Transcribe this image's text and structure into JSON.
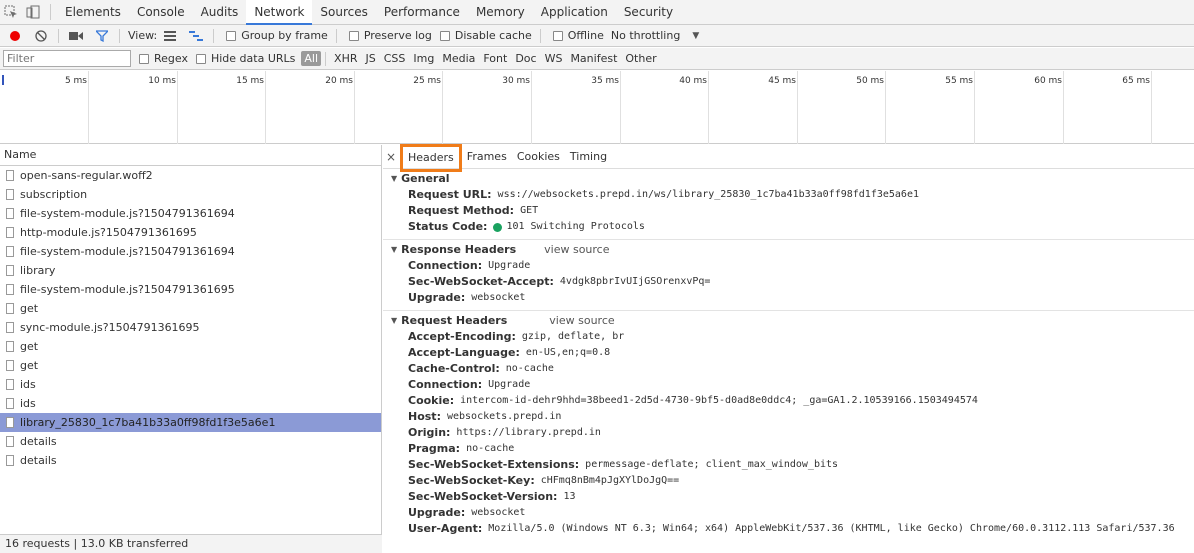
{
  "tabs": [
    "Elements",
    "Console",
    "Audits",
    "Network",
    "Sources",
    "Performance",
    "Memory",
    "Application",
    "Security"
  ],
  "active_tab": "Network",
  "toolbar": {
    "view_label": "View:",
    "group_by_frame": "Group by frame",
    "preserve_log": "Preserve log",
    "disable_cache": "Disable cache",
    "offline": "Offline",
    "throttling": "No throttling"
  },
  "filterbar": {
    "placeholder": "Filter",
    "regex": "Regex",
    "hide_data_urls": "Hide data URLs",
    "types": [
      "All",
      "XHR",
      "JS",
      "CSS",
      "Img",
      "Media",
      "Font",
      "Doc",
      "WS",
      "Manifest",
      "Other"
    ]
  },
  "timeline_ticks": [
    "5 ms",
    "10 ms",
    "15 ms",
    "20 ms",
    "25 ms",
    "30 ms",
    "35 ms",
    "40 ms",
    "45 ms",
    "50 ms",
    "55 ms",
    "60 ms",
    "65 ms"
  ],
  "list": {
    "header": "Name",
    "rows": [
      "open-sans-regular.woff2",
      "subscription",
      "file-system-module.js?1504791361694",
      "http-module.js?1504791361695",
      "file-system-module.js?1504791361694",
      "library",
      "file-system-module.js?1504791361695",
      "get",
      "sync-module.js?1504791361695",
      "get",
      "get",
      "ids",
      "ids",
      "library_25830_1c7ba41b33a0ff98fd1f3e5a6e1",
      "details",
      "details"
    ],
    "selected_index": 13,
    "status": "16 requests  |  13.0 KB transferred"
  },
  "details": {
    "tabs": [
      "Headers",
      "Frames",
      "Cookies",
      "Timing"
    ],
    "close": "×",
    "general": {
      "title": "General",
      "items": [
        {
          "key": "Request URL:",
          "value": "wss://websockets.prepd.in/ws/library_25830_1c7ba41b33a0ff98fd1f3e5a6e1"
        },
        {
          "key": "Request Method:",
          "value": "GET"
        },
        {
          "key": "Status Code:",
          "value": "101 Switching Protocols"
        }
      ]
    },
    "response": {
      "title": "Response Headers",
      "view_source": "view source",
      "items": [
        {
          "key": "Connection:",
          "value": "Upgrade"
        },
        {
          "key": "Sec-WebSocket-Accept:",
          "value": "4vdgk8pbrIvUIjGSOrenxvPq="
        },
        {
          "key": "Upgrade:",
          "value": "websocket"
        }
      ]
    },
    "request": {
      "title": "Request Headers",
      "view_source": "view source",
      "items": [
        {
          "key": "Accept-Encoding:",
          "value": "gzip, deflate, br"
        },
        {
          "key": "Accept-Language:",
          "value": "en-US,en;q=0.8"
        },
        {
          "key": "Cache-Control:",
          "value": "no-cache"
        },
        {
          "key": "Connection:",
          "value": "Upgrade"
        },
        {
          "key": "Cookie:",
          "value": "intercom-id-dehr9hhd=38beed1-2d5d-4730-9bf5-d0ad8e0ddc4; _ga=GA1.2.10539166.1503494574"
        },
        {
          "key": "Host:",
          "value": "websockets.prepd.in"
        },
        {
          "key": "Origin:",
          "value": "https://library.prepd.in"
        },
        {
          "key": "Pragma:",
          "value": "no-cache"
        },
        {
          "key": "Sec-WebSocket-Extensions:",
          "value": "permessage-deflate; client_max_window_bits"
        },
        {
          "key": "Sec-WebSocket-Key:",
          "value": "cHFmq8nBm4pJgXYlDoJgQ=="
        },
        {
          "key": "Sec-WebSocket-Version:",
          "value": "13"
        },
        {
          "key": "Upgrade:",
          "value": "websocket"
        },
        {
          "key": "User-Agent:",
          "value": "Mozilla/5.0 (Windows NT 6.3; Win64; x64) AppleWebKit/537.36 (KHTML, like Gecko) Chrome/60.0.3112.113 Safari/537.36"
        }
      ]
    }
  }
}
